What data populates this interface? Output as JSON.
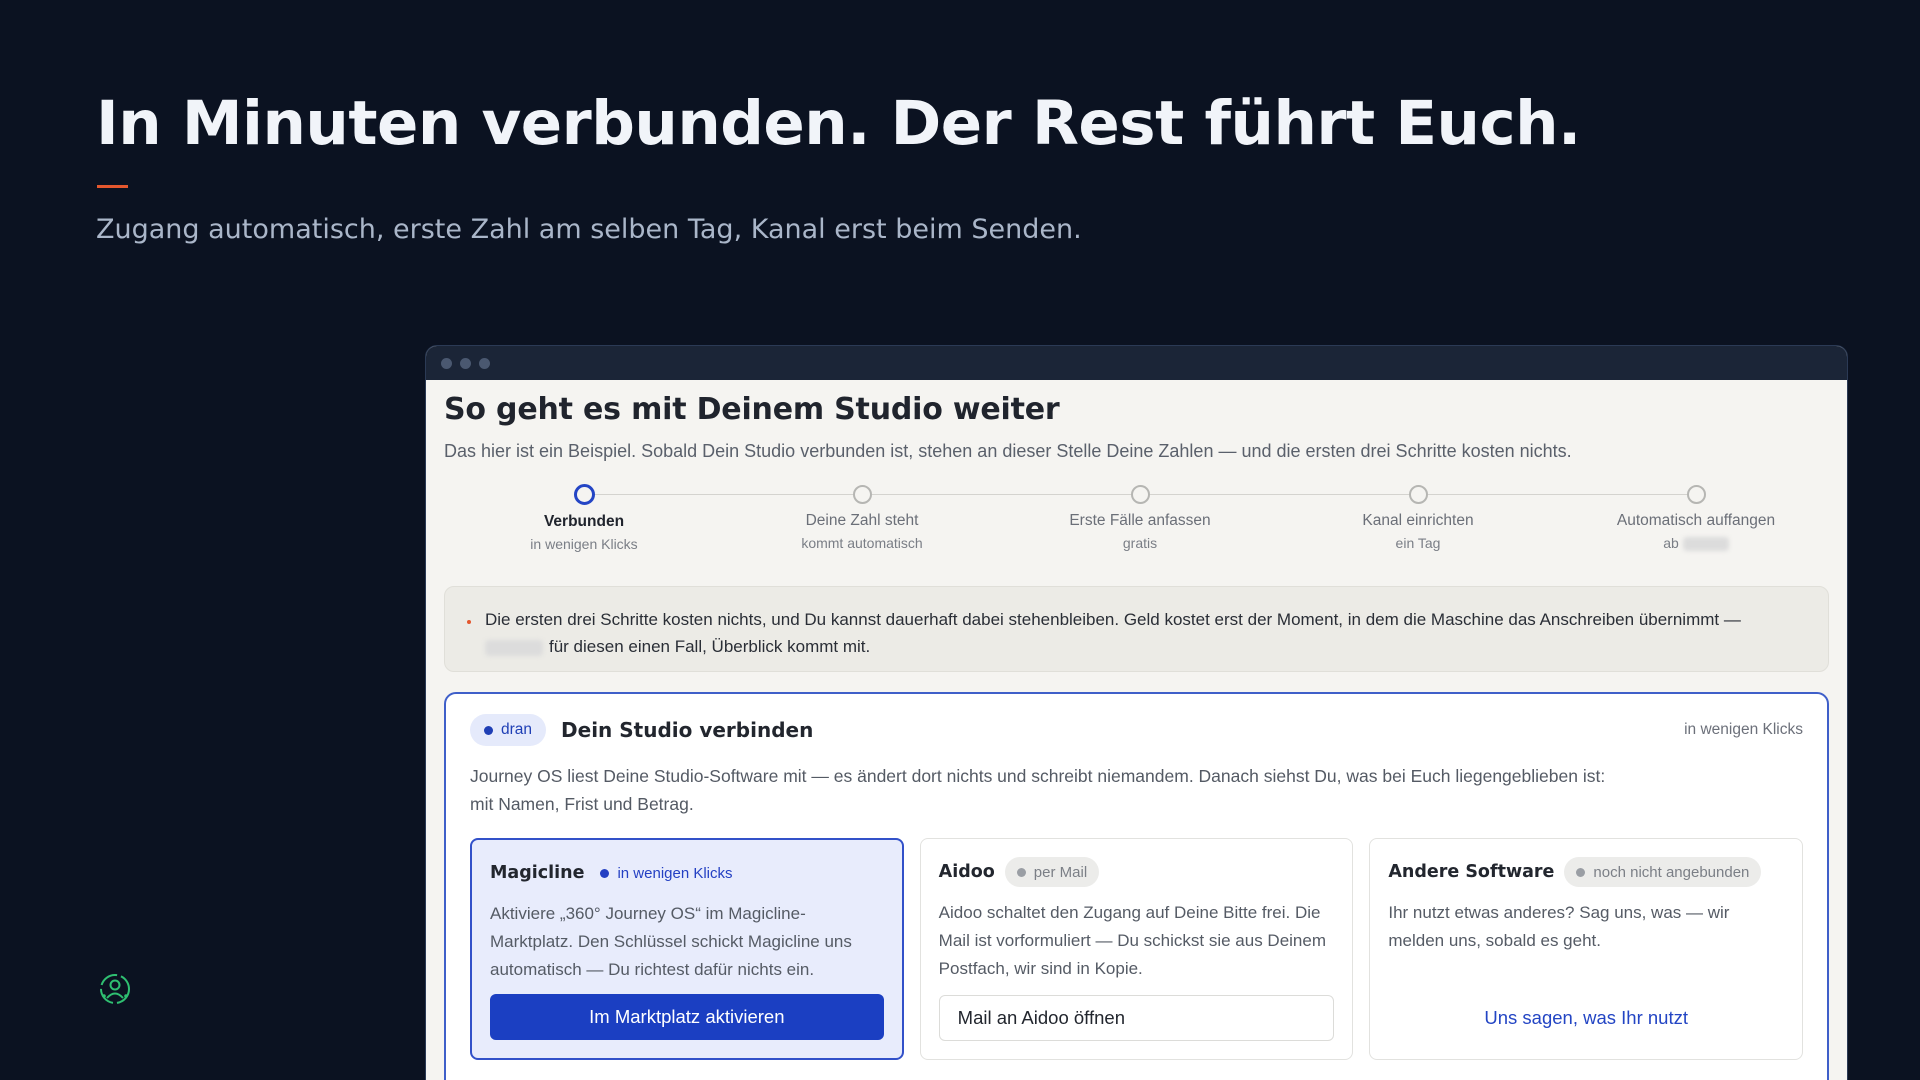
{
  "slide": {
    "headline": "In Minuten verbunden. Der Rest führt Euch.",
    "subline": "Zugang automatisch, erste Zahl am selben Tag, Kanal erst beim Senden.",
    "logo_icon": "person-circle-icon",
    "accent_color": "#e4572e"
  },
  "app": {
    "title": "So geht es mit Deinem Studio weiter",
    "intro": "Das hier ist ein Beispiel. Sobald Dein Studio verbunden ist, stehen an dieser Stelle Deine Zahlen — und die ersten drei Schritte kosten nichts.",
    "steps": [
      {
        "label": "Verbunden",
        "sub": "in wenigen Klicks",
        "active": true
      },
      {
        "label": "Deine Zahl steht",
        "sub": "kommt automatisch"
      },
      {
        "label": "Erste Fälle anfassen",
        "sub": "gratis"
      },
      {
        "label": "Kanal einrichten",
        "sub": "ein Tag"
      },
      {
        "label": "Automatisch auffangen",
        "sub": "ab"
      }
    ],
    "info": {
      "line1": "Die ersten drei Schritte kosten nichts, und Du kannst dauerhaft dabei stehenbleiben. Geld kostet erst der Moment, in dem die Maschine das Anschreiben übernimmt —",
      "line2": "für diesen einen Fall, Überblick kommt mit."
    },
    "card": {
      "badge": "dran",
      "title": "Dein Studio verbinden",
      "meta": "in wenigen Klicks",
      "description": "Journey OS liest Deine Studio-Software mit — es ändert dort nichts und schreibt niemandem. Danach siehst Du, was bei Euch liegengeblieben ist: mit Namen, Frist und Betrag.",
      "options": [
        {
          "name": "Magicline",
          "badge": "in wenigen Klicks",
          "text": "Aktiviere „360° Journey OS“ im Magicline-Marktplatz. Den Schlüssel schickt Magicline uns automatisch — Du richtest dafür nichts ein.",
          "button": "Im Marktplatz aktivieren"
        },
        {
          "name": "Aidoo",
          "badge": "per Mail",
          "text": "Aidoo schaltet den Zugang auf Deine Bitte frei. Die Mail ist vorformuliert — Du schickst sie aus Deinem Postfach, wir sind in Kopie.",
          "button": "Mail an Aidoo öffnen"
        },
        {
          "name": "Andere Software",
          "badge": "noch nicht angebunden",
          "text": "Ihr nutzt etwas anderes? Sag uns, was — wir melden uns, sobald es geht.",
          "button": "Uns sagen, was Ihr nutzt"
        }
      ]
    }
  }
}
